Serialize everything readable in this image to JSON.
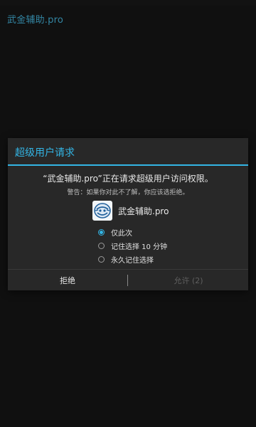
{
  "app": {
    "title": "武金辅助.pro"
  },
  "dialog": {
    "title": "超级用户请求",
    "message": "“武金辅助.pro”正在请求超级用户访问权限。",
    "warning": "警告：如果你对此不了解，你应该选拒绝。",
    "app_name": "武金辅助.pro",
    "options": [
      {
        "label": "仅此次",
        "checked": true
      },
      {
        "label": "记住选择 10 分钟",
        "checked": false
      },
      {
        "label": "永久记住选择",
        "checked": false
      }
    ],
    "deny_label": "拒绝",
    "allow_label": "允许 (2)"
  },
  "colors": {
    "accent": "#33b5e5",
    "background": "#141414",
    "dialog": "#282828"
  }
}
